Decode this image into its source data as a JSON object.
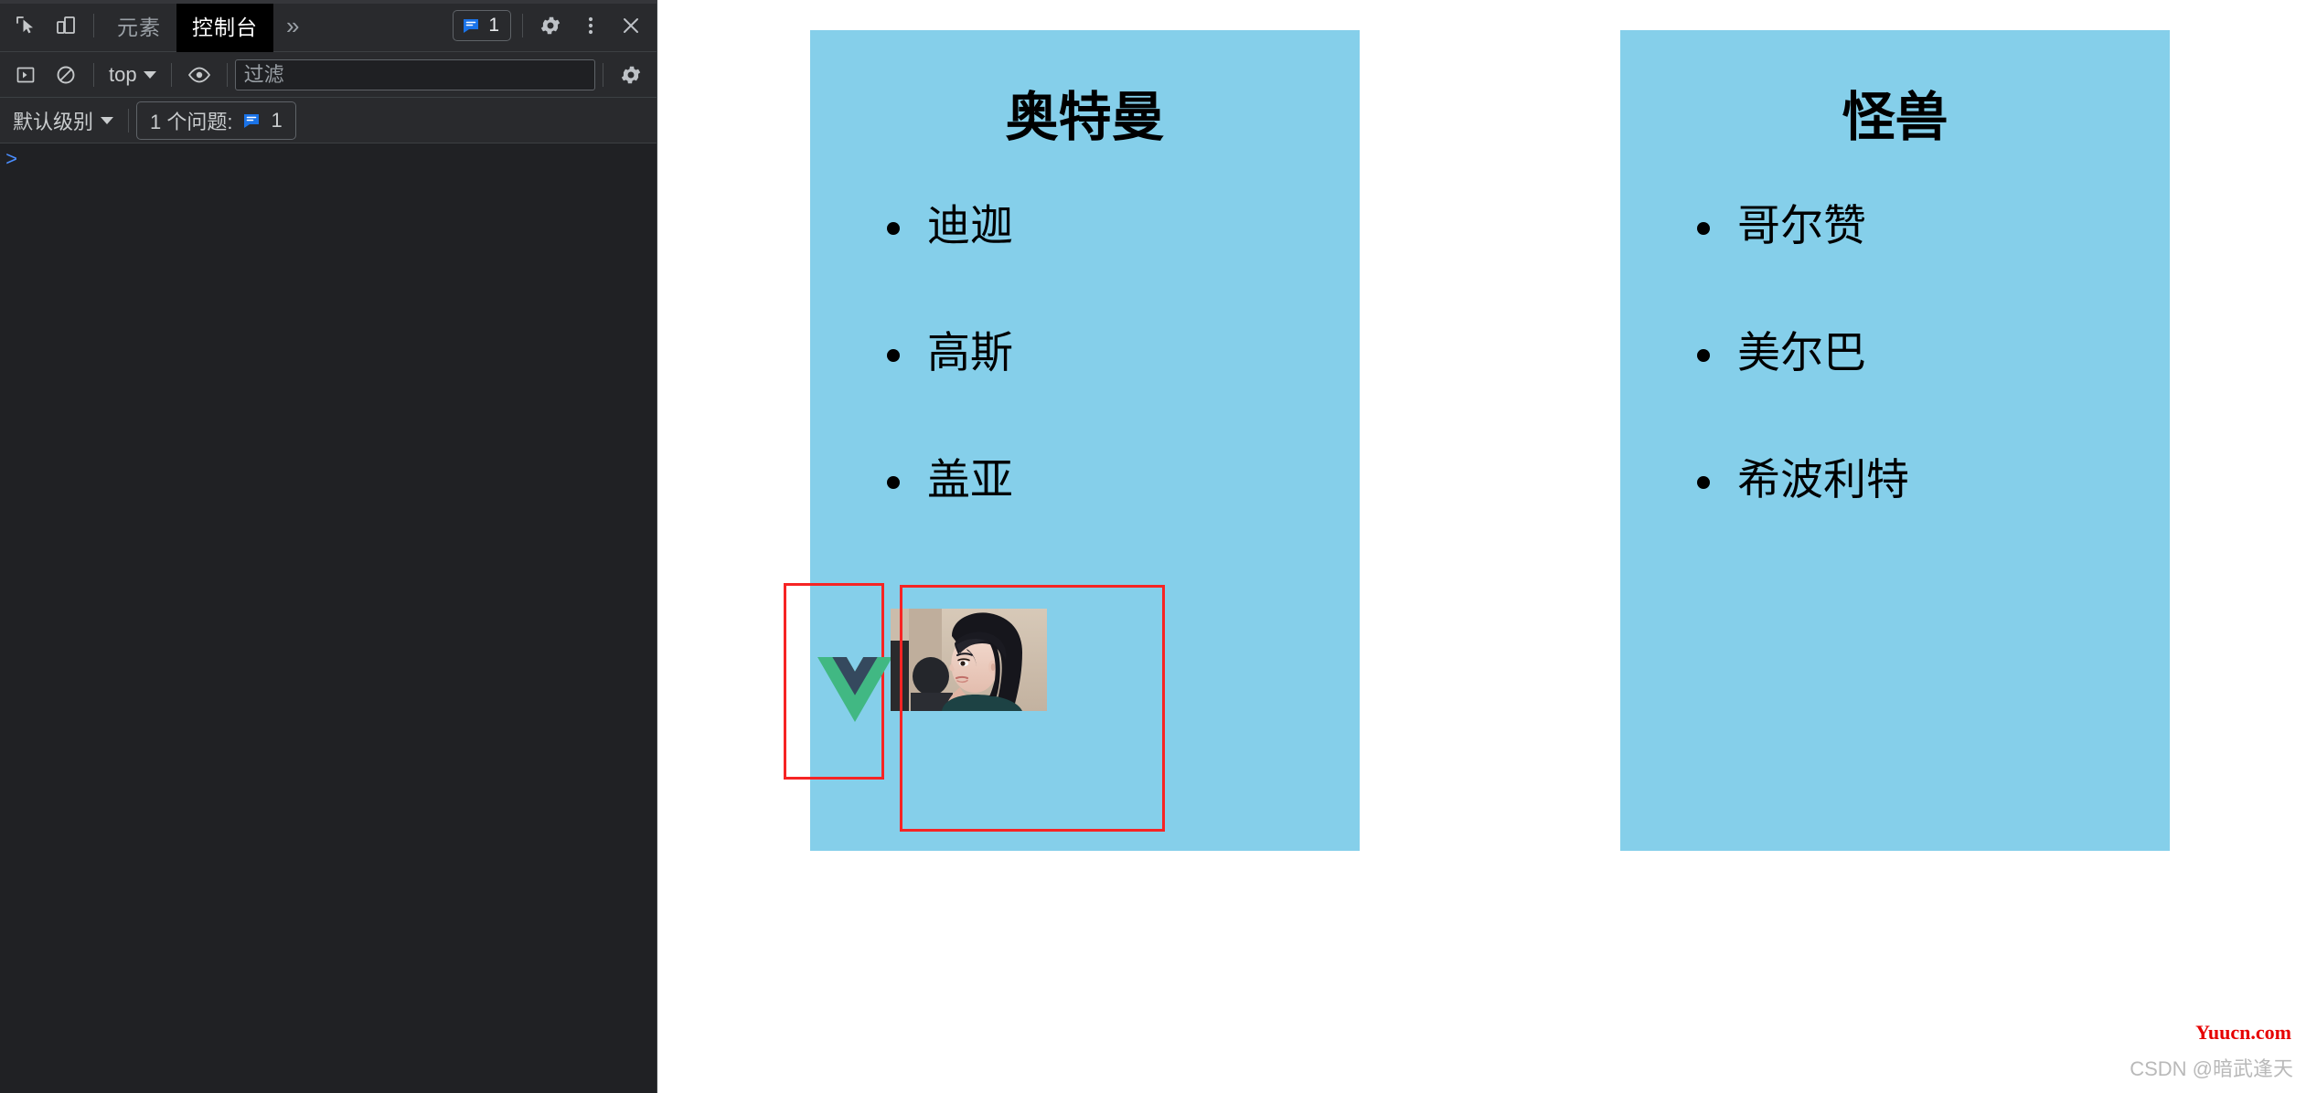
{
  "devtools": {
    "toolbar": {
      "inspect_icon": "inspect-element-icon",
      "device_icon": "device-toolbar-icon",
      "tabs": [
        {
          "id": "elements",
          "label": "元素",
          "active": false
        },
        {
          "id": "console",
          "label": "控制台",
          "active": true
        }
      ],
      "more_tabs_label": "»",
      "issues_count": "1",
      "issues_icon": "issue-message-icon",
      "settings_icon": "gear-icon",
      "more_options_icon": "kebab-menu-icon",
      "close_icon": "close-icon"
    },
    "filterbar": {
      "sidebar_icon": "show-console-sidebar-icon",
      "clear_icon": "clear-console-icon",
      "context": "top",
      "eye_icon": "live-expressions-eye-icon",
      "filter_placeholder": "过滤",
      "filter_value": "",
      "settings_icon": "console-settings-gear-icon"
    },
    "levelbar": {
      "level_label": "默认级别",
      "issues_text": "1 个问题:",
      "issues_icon": "issue-message-icon",
      "issues_count": "1"
    },
    "console": {
      "prompt": ">"
    },
    "colors": {
      "panel_bg": "#202124",
      "toolbar_bg": "#292a2d",
      "active_tab_bg": "#000000",
      "text_muted": "#9aa0a6",
      "accent_blue": "#4b8eff"
    }
  },
  "page": {
    "cards": [
      {
        "id": "ultraman",
        "title": "奥特曼",
        "items": [
          "迪迦",
          "高斯",
          "盖亚"
        ],
        "bg": "#85cfea",
        "media": {
          "vue_logo_alt": "vue-logo",
          "vue_green": "#41b883",
          "vue_navy": "#35495e",
          "photo_alt": "person-portrait-photo",
          "highlight_border": "#f62424"
        }
      },
      {
        "id": "monster",
        "title": "怪兽",
        "items": [
          "哥尔赞",
          "美尔巴",
          "希波利特"
        ],
        "bg": "#85cfea"
      }
    ],
    "watermarks": {
      "site": "Yuucn.com",
      "author": "CSDN @暗武逢天"
    }
  }
}
